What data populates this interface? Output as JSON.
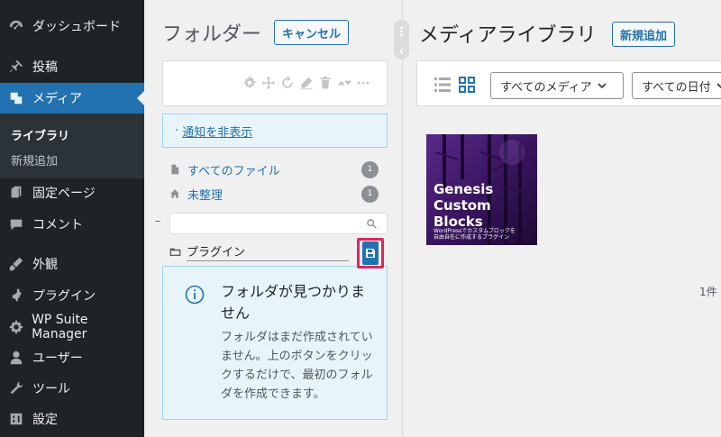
{
  "sidebar": {
    "items": [
      {
        "label": "ダッシュボード",
        "icon": "dashboard-icon"
      },
      {
        "label": "投稿",
        "icon": "pin-icon"
      },
      {
        "label": "メディア",
        "icon": "media-icon"
      },
      {
        "label": "固定ページ",
        "icon": "page-icon"
      },
      {
        "label": "コメント",
        "icon": "comment-icon"
      },
      {
        "label": "外観",
        "icon": "appearance-icon"
      },
      {
        "label": "プラグイン",
        "icon": "plugin-icon"
      },
      {
        "label": "WP Suite Manager",
        "icon": "gear-icon"
      },
      {
        "label": "ユーザー",
        "icon": "user-icon"
      },
      {
        "label": "ツール",
        "icon": "wrench-icon"
      },
      {
        "label": "設定",
        "icon": "settings-icon"
      }
    ],
    "submenu": [
      {
        "label": "ライブラリ"
      },
      {
        "label": "新規追加"
      }
    ]
  },
  "folder_panel": {
    "title": "フォルダー",
    "cancel_label": "キャンセル",
    "notice_prefix": "·",
    "notice_link": "通知を非表示",
    "folders": [
      {
        "label": "すべてのファイル",
        "count": "1",
        "icon": "file-icon"
      },
      {
        "label": "未整理",
        "count": "1",
        "icon": "home-icon"
      }
    ],
    "collapse_symbol": "–",
    "new_folder_value": "プラグイン",
    "empty_title": "フォルダが見つかりません",
    "empty_text": "フォルダはまだ作成されていません。上のボタンをクリックするだけで、最初のフォルダを作成できます。"
  },
  "media_library": {
    "title": "メディアライブラリ",
    "add_new_label": "新規追加",
    "filter_type": "すべてのメディア",
    "filter_date": "すべての日付",
    "item_count": "1件",
    "thumbnail": {
      "title_lines": [
        "Genesis",
        "Custom",
        "Blocks"
      ],
      "subtitle_lines": [
        "WordPressでカスタムブロックを",
        "自由自在に作成するプラグイン"
      ]
    }
  },
  "colors": {
    "sidebar_bg": "#1d2327",
    "accent": "#2271b1",
    "highlight_frame": "#e0245e",
    "notice_bg": "#e7f5fb"
  }
}
